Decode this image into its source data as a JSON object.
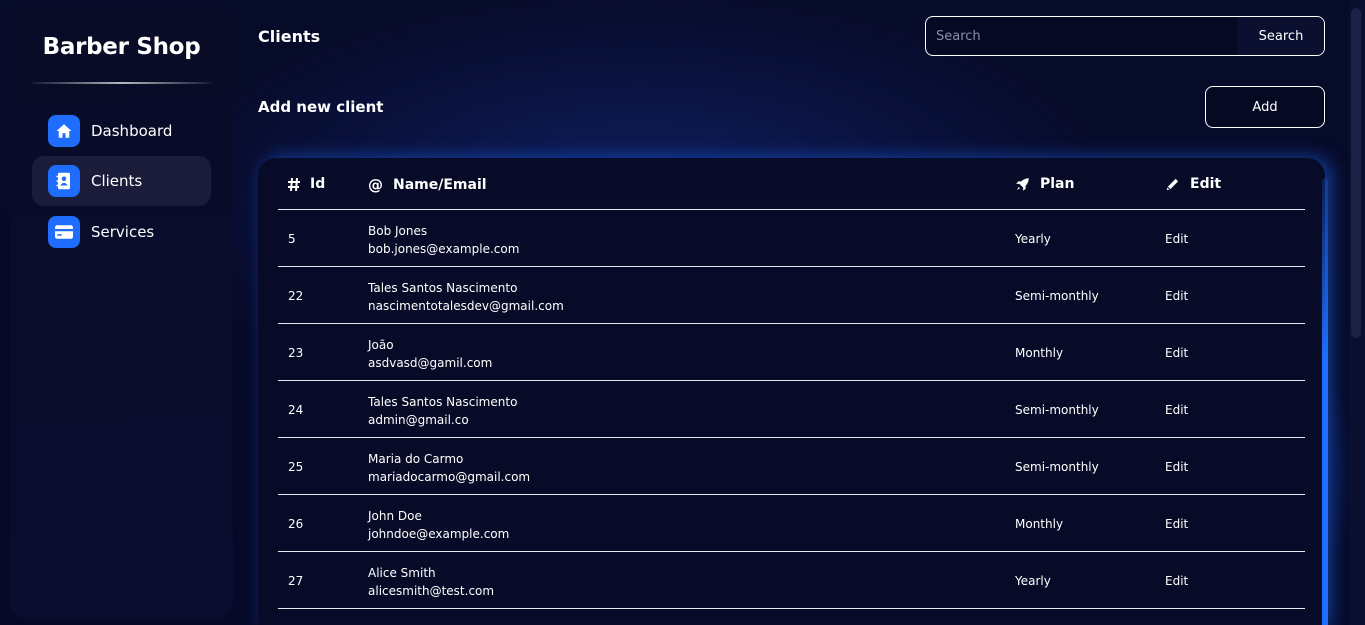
{
  "sidebar": {
    "brand": "Barber Shop",
    "items": [
      {
        "label": "Dashboard",
        "icon": "home-icon"
      },
      {
        "label": "Clients",
        "icon": "contact-card-icon",
        "active": true
      },
      {
        "label": "Services",
        "icon": "credit-card-icon"
      }
    ]
  },
  "header": {
    "title": "Clients",
    "search": {
      "placeholder": "Search",
      "value": "",
      "button_label": "Search"
    }
  },
  "add_section": {
    "label": "Add new client",
    "button_label": "Add"
  },
  "table": {
    "columns": [
      {
        "label": "Id",
        "icon": "hash-icon"
      },
      {
        "label": "Name/Email",
        "icon": "at-icon"
      },
      {
        "label": "Plan",
        "icon": "rocket-icon"
      },
      {
        "label": "Edit",
        "icon": "pencil-icon"
      }
    ],
    "rows": [
      {
        "id": "5",
        "name": "Bob Jones",
        "email": "bob.jones@example.com",
        "plan": "Yearly",
        "edit": "Edit"
      },
      {
        "id": "22",
        "name": "Tales Santos Nascimento",
        "email": "nascimentotalesdev@gmail.com",
        "plan": "Semi-monthly",
        "edit": "Edit"
      },
      {
        "id": "23",
        "name": "João",
        "email": "asdvasd@gamil.com",
        "plan": "Monthly",
        "edit": "Edit"
      },
      {
        "id": "24",
        "name": "Tales Santos Nascimento",
        "email": "admin@gmail.co",
        "plan": "Semi-monthly",
        "edit": "Edit"
      },
      {
        "id": "25",
        "name": "Maria do Carmo",
        "email": "mariadocarmo@gmail.com",
        "plan": "Semi-monthly",
        "edit": "Edit"
      },
      {
        "id": "26",
        "name": "John Doe",
        "email": "johndoe@example.com",
        "plan": "Monthly",
        "edit": "Edit"
      },
      {
        "id": "27",
        "name": "Alice Smith",
        "email": "alicesmith@test.com",
        "plan": "Yearly",
        "edit": "Edit"
      }
    ]
  },
  "colors": {
    "accent": "#1e6dff",
    "background": "#070b2a",
    "panel": "#080c26"
  }
}
